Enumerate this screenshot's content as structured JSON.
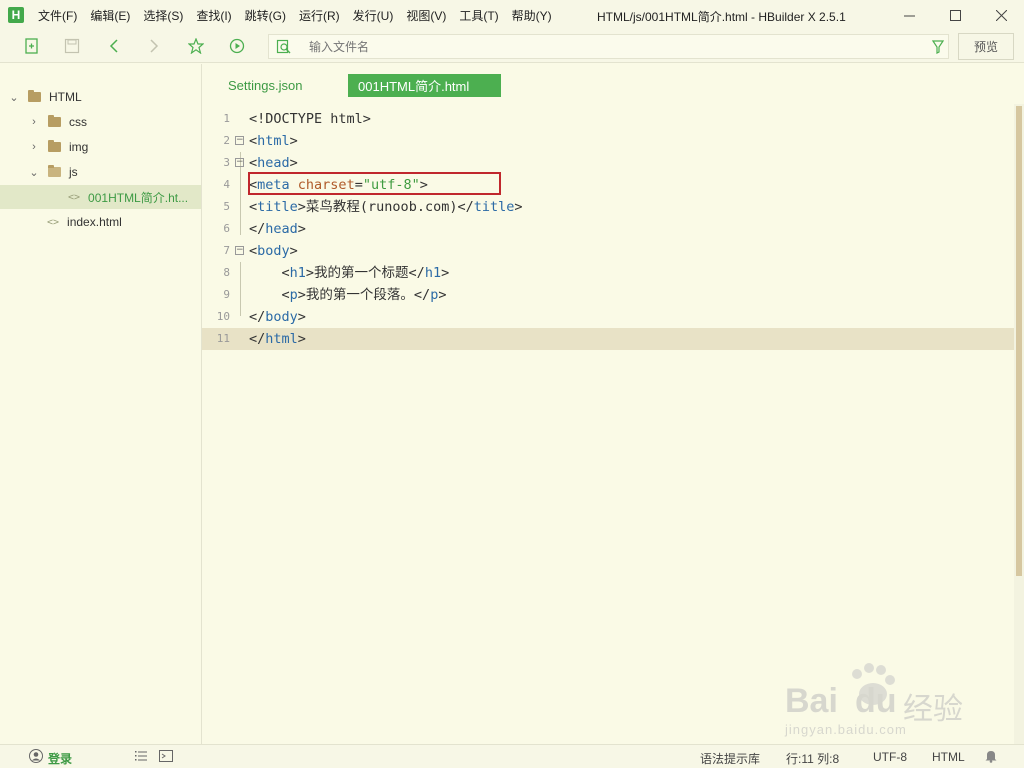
{
  "app": {
    "logo_letter": "H",
    "window_title": "HTML/js/001HTML简介.html - HBuilder X 2.5.1",
    "menu": [
      "文件(F)",
      "编辑(E)",
      "选择(S)",
      "查找(I)",
      "跳转(G)",
      "运行(R)",
      "发行(U)",
      "视图(V)",
      "工具(T)",
      "帮助(Y)"
    ],
    "accent_color": "#4caf50"
  },
  "toolbar": {
    "search_placeholder": "输入文件名",
    "preview_label": "预览"
  },
  "sidebar": {
    "items": [
      {
        "label": "HTML",
        "type": "folder",
        "expanded": true
      },
      {
        "label": "css",
        "type": "folder",
        "expanded": false
      },
      {
        "label": "img",
        "type": "folder",
        "expanded": false
      },
      {
        "label": "js",
        "type": "folder",
        "expanded": true
      },
      {
        "label": "001HTML简介.ht...",
        "type": "file",
        "selected": true
      },
      {
        "label": "index.html",
        "type": "file"
      }
    ]
  },
  "tabs": [
    {
      "label": "Settings.json",
      "active": false
    },
    {
      "label": "001HTML简介.html",
      "active": true
    }
  ],
  "editor": {
    "current_line": 11,
    "lines": [
      {
        "n": "1",
        "text": "<!DOCTYPE html>"
      },
      {
        "n": "2",
        "text": "<html>"
      },
      {
        "n": "3",
        "text": "<head>"
      },
      {
        "n": "4",
        "text": "<meta charset=\"utf-8\">"
      },
      {
        "n": "5",
        "text": "<title>菜鸟教程(runoob.com)</title>"
      },
      {
        "n": "6",
        "text": "</head>"
      },
      {
        "n": "7",
        "text": "<body>"
      },
      {
        "n": "8",
        "text": "    <h1>我的第一个标题</h1>"
      },
      {
        "n": "9",
        "text": "    <p>我的第一个段落。</p>"
      },
      {
        "n": "10",
        "text": "</body>"
      },
      {
        "n": "11",
        "text": "</html>"
      }
    ]
  },
  "statusbar": {
    "login": "登录",
    "syntax_hint": "语法提示库",
    "position": "行:11  列:8",
    "encoding": "UTF-8",
    "language": "HTML"
  },
  "watermark": {
    "brand": "Bai",
    "brand2": "du",
    "suffix": "经验",
    "url": "jingyan.baidu.com"
  }
}
